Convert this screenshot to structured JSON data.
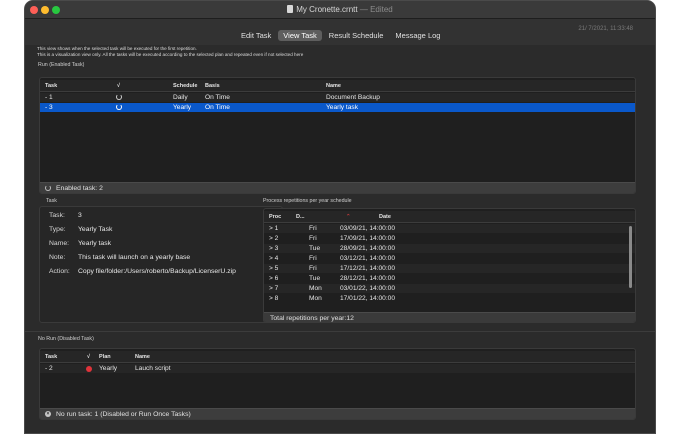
{
  "window": {
    "title": "My Cronette.crntt",
    "edited_label": "— Edited",
    "timestamp": "21/ 7/2021, 11:33:48"
  },
  "tabs": [
    {
      "label": "Edit Task",
      "active": false
    },
    {
      "label": "View Task",
      "active": true
    },
    {
      "label": "Result Schedule",
      "active": false
    },
    {
      "label": "Message Log",
      "active": false
    }
  ],
  "info": {
    "line1": "This view shows when the selected task will be executed for the first repetition.",
    "line2": "This is a visualization view only. All the tasks will be executed according to the selected plan and repeated even if not selected here"
  },
  "run_section": {
    "label": "Run (Enabled Task)",
    "headers": {
      "task": "Task",
      "check": "√",
      "schedule": "Schedule",
      "basis": "Basis",
      "name": "Name"
    },
    "rows": [
      {
        "task": "- 1",
        "icon": "cycle-icon",
        "schedule": "Daily",
        "basis": "On Time",
        "name": "Document Backup",
        "selected": false
      },
      {
        "task": "- 3",
        "icon": "cycle-icon",
        "schedule": "Yearly",
        "basis": "On Time",
        "name": "Yearly task",
        "selected": true
      }
    ],
    "status": "Enabled task: 2"
  },
  "task_detail": {
    "label": "Task",
    "fields": [
      {
        "key": "Task:",
        "value": "3"
      },
      {
        "key": "Type:",
        "value": "Yearly Task"
      },
      {
        "key": "Name:",
        "value": "Yearly task"
      },
      {
        "key": "Note:",
        "value": "This task will launch on a yearly base"
      },
      {
        "key": "Action:",
        "value": "Copy file/folder:/Users/roberto/Backup/LicenserU.zip"
      }
    ]
  },
  "repetitions": {
    "label": "Process repetitions per year schedule",
    "headers": {
      "proc": "Proc",
      "day": "D...",
      "date": "Date"
    },
    "rows": [
      {
        "proc": "> 1",
        "day": "Fri",
        "date": "03/09/21, 14:00:00"
      },
      {
        "proc": "> 2",
        "day": "Fri",
        "date": "17/09/21, 14:00:00"
      },
      {
        "proc": "> 3",
        "day": "Tue",
        "date": "28/09/21, 14:00:00"
      },
      {
        "proc": "> 4",
        "day": "Fri",
        "date": "03/12/21, 14:00:00"
      },
      {
        "proc": "> 5",
        "day": "Fri",
        "date": "17/12/21, 14:00:00"
      },
      {
        "proc": "> 6",
        "day": "Tue",
        "date": "28/12/21, 14:00:00"
      },
      {
        "proc": "> 7",
        "day": "Mon",
        "date": "03/01/22, 14:00:00"
      },
      {
        "proc": "> 8",
        "day": "Mon",
        "date": "17/01/22, 14:00:00"
      }
    ],
    "footer": "Total repetitions per year:12"
  },
  "norun_section": {
    "label": "No Run (Disabled Task)",
    "headers": {
      "task": "Task",
      "check": "√",
      "plan": "Plan",
      "name": "Name"
    },
    "rows": [
      {
        "task": "- 2",
        "icon": "red-dot",
        "plan": "Yearly",
        "name": "Lauch script"
      }
    ],
    "status": "No run task: 1 (Disabled or Run Once Tasks)"
  },
  "colors": {
    "selection": "#0a58ca",
    "disabled_dot": "#e0333a",
    "window_bg": "#2b2b2b"
  }
}
